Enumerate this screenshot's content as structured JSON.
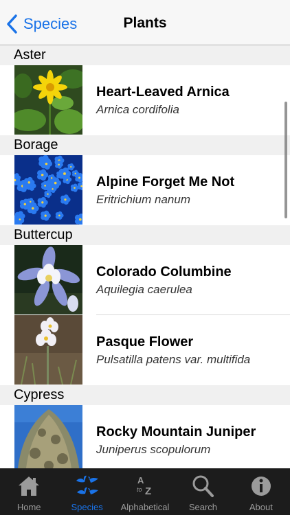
{
  "nav": {
    "back_label": "Species",
    "title": "Plants"
  },
  "sections": [
    {
      "name": "Aster",
      "rows": [
        {
          "common": "Heart-Leaved Arnica",
          "scientific": "Arnica cordifolia"
        }
      ]
    },
    {
      "name": "Borage",
      "rows": [
        {
          "common": "Alpine Forget Me Not",
          "scientific": "Eritrichium nanum"
        }
      ]
    },
    {
      "name": "Buttercup",
      "rows": [
        {
          "common": "Colorado Columbine",
          "scientific": "Aquilegia caerulea"
        },
        {
          "common": "Pasque Flower",
          "scientific": "Pulsatilla  patens var. multifida"
        }
      ]
    },
    {
      "name": "Cypress",
      "rows": [
        {
          "common": "Rocky Mountain Juniper",
          "scientific": "Juniperus scopulorum"
        }
      ]
    }
  ],
  "tabs": [
    {
      "label": "Home",
      "icon": "home-icon"
    },
    {
      "label": "Species",
      "icon": "birds-icon",
      "active": true
    },
    {
      "label": "Alphabetical",
      "icon": "a-to-z-icon"
    },
    {
      "label": "Search",
      "icon": "search-icon"
    },
    {
      "label": "About",
      "icon": "info-icon"
    }
  ],
  "colors": {
    "accent": "#1a73e8",
    "tabbar": "#1c1c1c",
    "section_bg": "#f0f0f0"
  }
}
